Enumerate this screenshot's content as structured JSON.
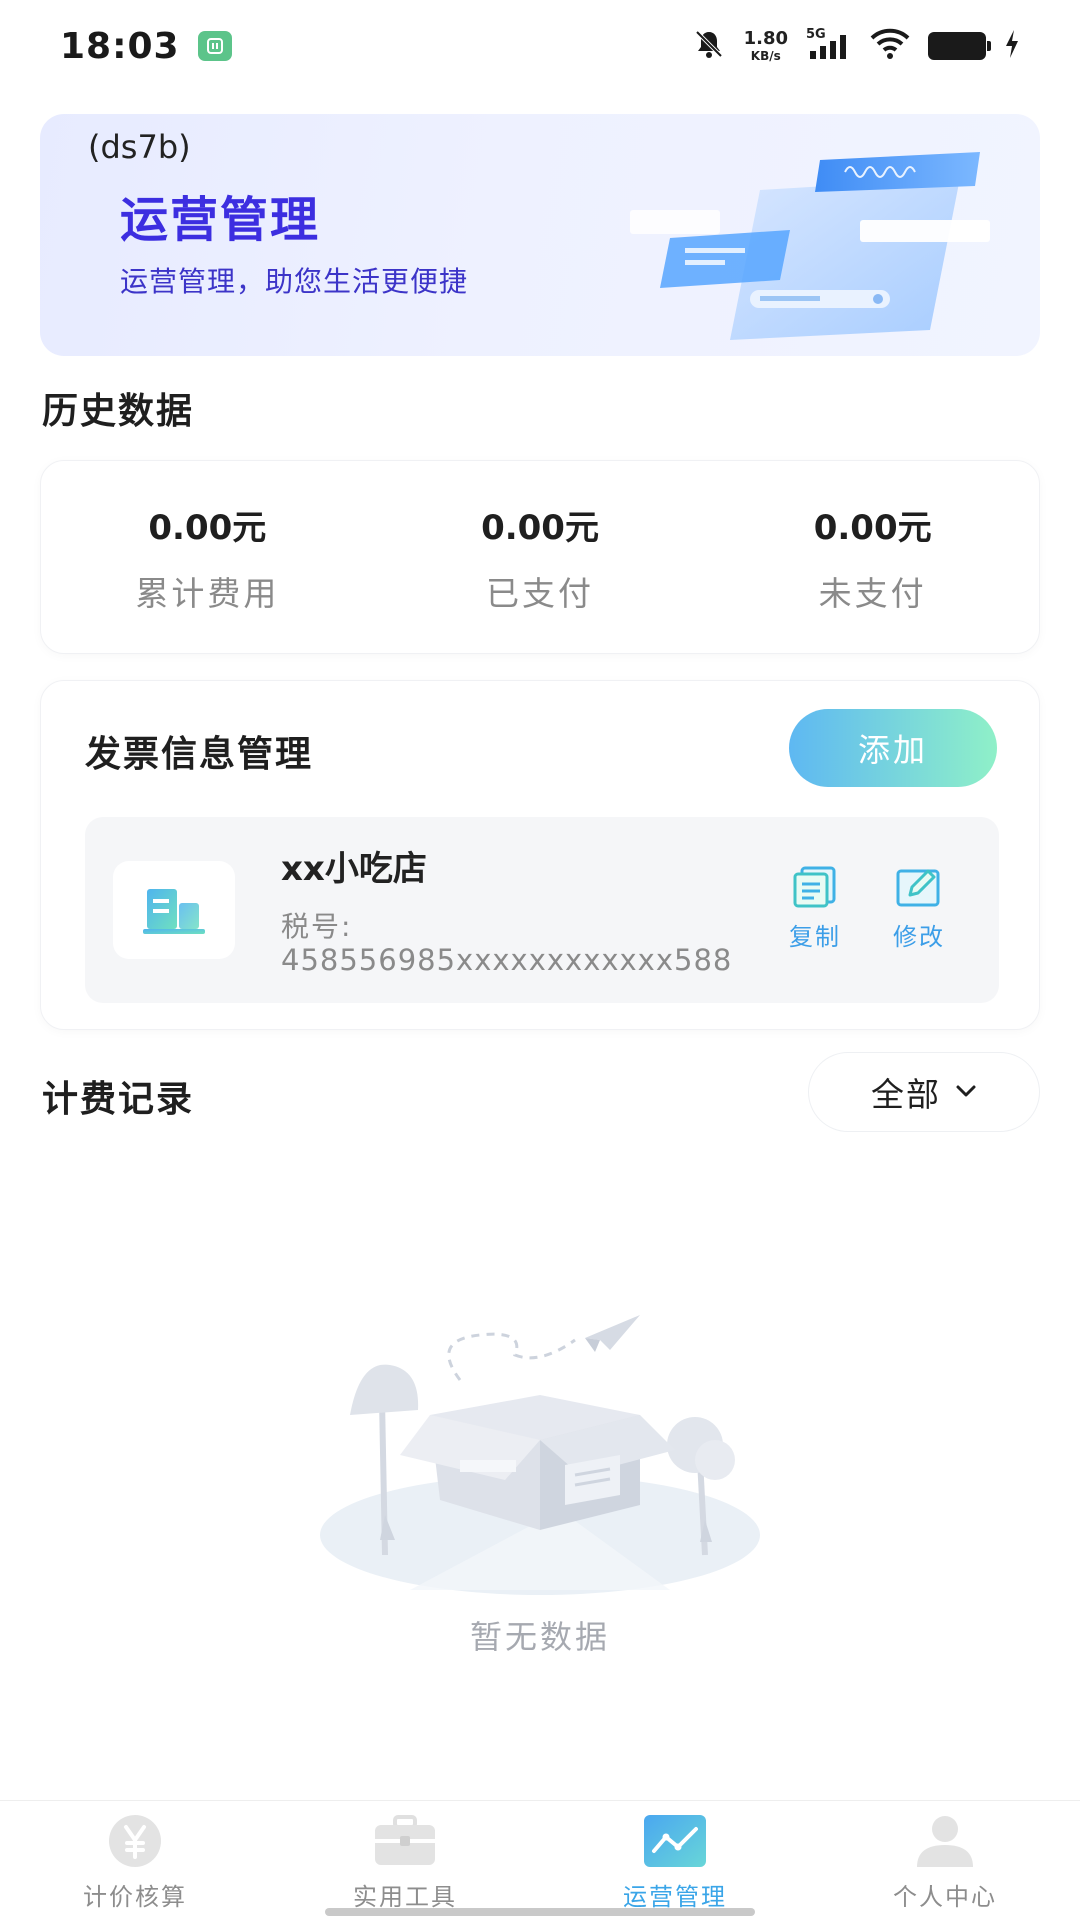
{
  "status_bar": {
    "time": "18:03",
    "net_speed_value": "1.80",
    "net_speed_unit": "KB/s",
    "network_type": "5G"
  },
  "banner": {
    "code": "(ds7b)",
    "title": "运营管理",
    "subtitle": "运营管理，助您生活更便捷"
  },
  "history": {
    "title": "历史数据",
    "stats": [
      {
        "value": "0.00元",
        "label": "累计费用"
      },
      {
        "value": "0.00元",
        "label": "已支付"
      },
      {
        "value": "0.00元",
        "label": "未支付"
      }
    ]
  },
  "invoice": {
    "title": "发票信息管理",
    "add_label": "添加",
    "items": [
      {
        "company": "xx小吃店",
        "tax_label": "税号:",
        "tax_number": "458556985xxxxxxxxxxxx588",
        "copy_label": "复制",
        "edit_label": "修改"
      }
    ]
  },
  "billing": {
    "title": "计费记录",
    "filter_value": "全部",
    "empty_text": "暂无数据"
  },
  "bottom_nav": {
    "items": [
      {
        "label": "计价核算",
        "icon": "yen-icon",
        "active": false
      },
      {
        "label": "实用工具",
        "icon": "briefcase-icon",
        "active": false
      },
      {
        "label": "运营管理",
        "icon": "chart-icon",
        "active": true
      },
      {
        "label": "个人中心",
        "icon": "person-icon",
        "active": false
      }
    ]
  },
  "colors": {
    "accent": "#3aa5e8",
    "banner_title": "#3c2ee0",
    "add_button_start": "#5eb8f2",
    "add_button_end": "#8ff0c8"
  }
}
